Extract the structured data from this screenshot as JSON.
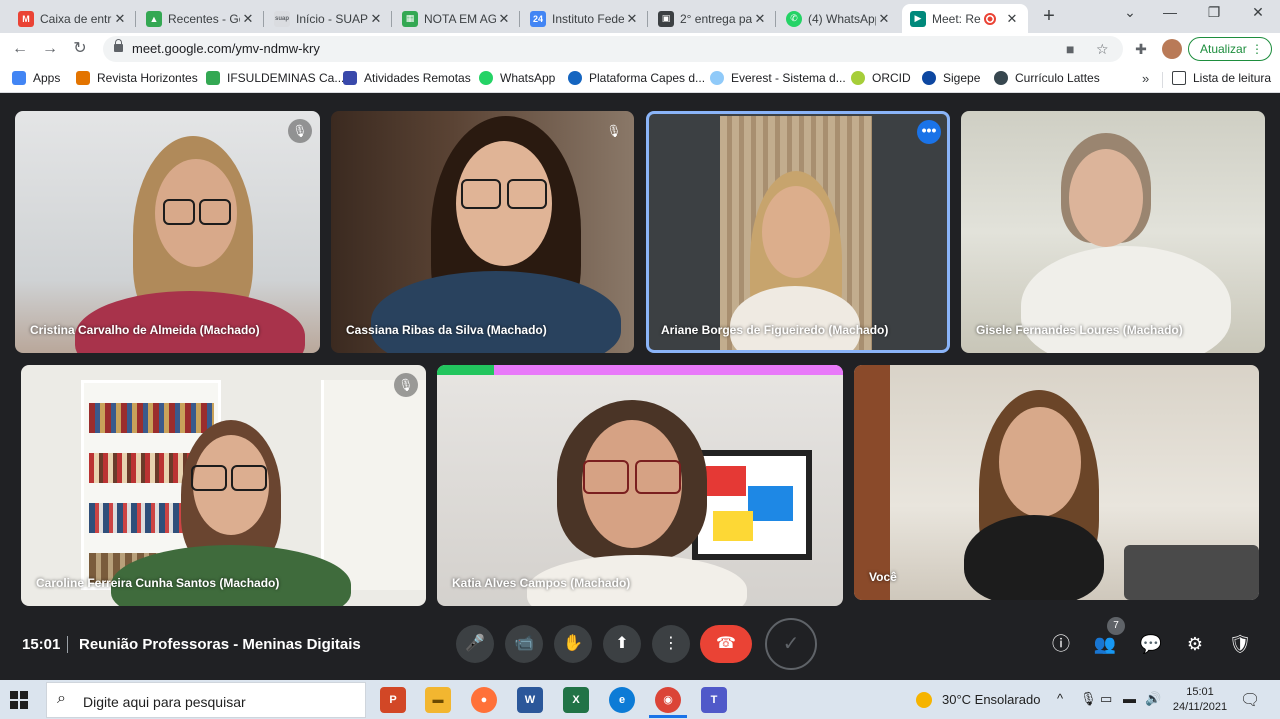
{
  "browser": {
    "tabs": [
      {
        "title": "Caixa de entr",
        "icon": "gmail-icon",
        "color": "#ea4335",
        "glyph": "M"
      },
      {
        "title": "Recentes - Go",
        "icon": "drive-icon",
        "color": "#34a853",
        "glyph": "▲"
      },
      {
        "title": "Início - SUAP",
        "icon": "suap-icon",
        "color": "#9aa0a6",
        "glyph": "suap"
      },
      {
        "title": "NOTA EM AG",
        "icon": "sheets-icon",
        "color": "#34a853",
        "glyph": "▦"
      },
      {
        "title": "Instituto Fede",
        "icon": "calendar-icon",
        "color": "#4285f4",
        "glyph": "24"
      },
      {
        "title": "2° entrega pa",
        "icon": "classroom-icon",
        "color": "#3c4043",
        "glyph": "▣"
      },
      {
        "title": "(4) WhatsApp",
        "icon": "whatsapp-icon",
        "color": "#25d366",
        "glyph": "✆"
      },
      {
        "title": "Meet: Re",
        "icon": "meet-icon",
        "color": "#00897b",
        "glyph": "▶",
        "recording": true
      }
    ],
    "new_tab": "+",
    "window_controls": {
      "dropdown": "⌄",
      "minimize": "—",
      "restore": "❐",
      "close": "✕"
    },
    "url": "meet.google.com/ymv-ndmw-kry",
    "update_label": "Atualizar",
    "bookmarks": [
      {
        "label": "Apps",
        "color": "#4285f4"
      },
      {
        "label": "Revista Horizontes",
        "color": "#e37400"
      },
      {
        "label": "IFSULDEMINAS Ca...",
        "color": "#34a853"
      },
      {
        "label": "Atividades Remotas",
        "color": "#3949ab"
      },
      {
        "label": "WhatsApp",
        "color": "#25d366"
      },
      {
        "label": "Plataforma Capes d...",
        "color": "#1565c0"
      },
      {
        "label": "Everest - Sistema d...",
        "color": "#90caf9"
      },
      {
        "label": "ORCID",
        "color": "#a6ce39"
      },
      {
        "label": "Sigepe",
        "color": "#0d47a1"
      },
      {
        "label": "Currículo Lattes",
        "color": "#37474f"
      }
    ],
    "bookmarks_more": "»",
    "reading_list": "Lista de leitura"
  },
  "meet": {
    "participants": [
      {
        "name": "Cristina Carvalho de Almeida (Machado)",
        "muted": true
      },
      {
        "name": "Cassiana Ribas da Silva (Machado)",
        "muted": true
      },
      {
        "name": "Ariane Borges de Figueiredo (Machado)",
        "muted": false,
        "active": true
      },
      {
        "name": "Gisele Fernandes Loures (Machado)",
        "muted": false
      },
      {
        "name": "Caroline Ferreira Cunha Santos (Machado)",
        "muted": true
      },
      {
        "name": "Katia Alves Campos (Machado)",
        "muted": false
      },
      {
        "name": "Você",
        "muted": false
      }
    ],
    "mute_glyph": "🎙",
    "more_glyph": "•••",
    "time": "15:01",
    "title": "Reunião Professoras - Meninas Digitais",
    "people_count": "7",
    "controls": {
      "mic": "🎤",
      "camera": "📹",
      "hand": "✋",
      "present": "⬆",
      "more": "⋮",
      "end": "☎",
      "record": "✓"
    },
    "right_icons": {
      "info": "ⓘ",
      "people": "👥",
      "chat": "💬",
      "activities": "⚙",
      "host": "🛡"
    }
  },
  "taskbar": {
    "search_placeholder": "Digite aqui para pesquisar",
    "apps": [
      {
        "name": "powerpoint-icon",
        "color": "#d24726",
        "glyph": "P"
      },
      {
        "name": "file-explorer-icon",
        "color": "#f2b630",
        "glyph": "▬"
      },
      {
        "name": "firefox-icon",
        "color": "#ff7139",
        "glyph": "●"
      },
      {
        "name": "word-icon",
        "color": "#2b579a",
        "glyph": "W"
      },
      {
        "name": "excel-icon",
        "color": "#217346",
        "glyph": "X"
      },
      {
        "name": "edge-icon",
        "color": "#0c7bd6",
        "glyph": "e"
      },
      {
        "name": "chrome-icon",
        "color": "#db4437",
        "glyph": "◉"
      },
      {
        "name": "teams-icon",
        "color": "#5059c9",
        "glyph": "T"
      }
    ],
    "weather": "30°C  Ensolarado",
    "clock_time": "15:01",
    "clock_date": "24/11/2021",
    "tray_expand": "^"
  }
}
